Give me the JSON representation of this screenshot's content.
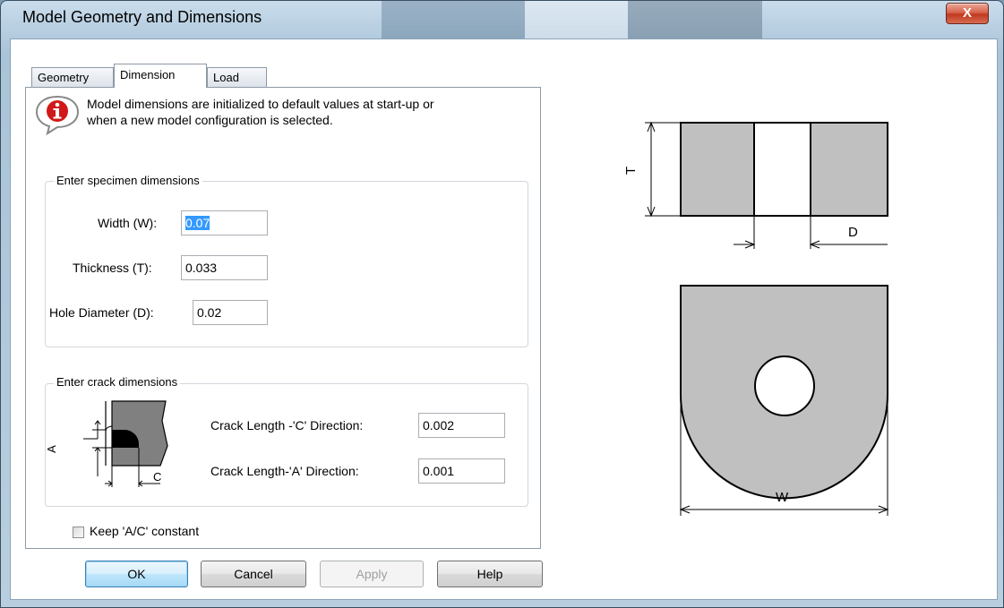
{
  "window": {
    "title": "Model Geometry and Dimensions",
    "close_label": "X"
  },
  "tabs": [
    {
      "label": "Geometry"
    },
    {
      "label": "Dimension"
    },
    {
      "label": "Load"
    }
  ],
  "info": {
    "line1": "Model dimensions are initialized to default values at start-up or",
    "line2": "when a new model  configuration  is  selected."
  },
  "specimen": {
    "legend": "Enter  specimen dimensions",
    "width_label": "Width (W):",
    "width_value": "0.07",
    "thickness_label": "Thickness (T):",
    "thickness_value": "0.033",
    "hole_label": "Hole Diameter (D):",
    "hole_value": "0.02"
  },
  "crack": {
    "legend": "Enter crack dimensions",
    "c_label": "Crack Length -'C' Direction:",
    "c_value": "0.002",
    "a_label": "Crack Length-'A'  Direction:",
    "a_value": "0.001",
    "diagram_a": "A",
    "diagram_c": "C"
  },
  "keep_constant": {
    "label": "Keep 'A/C' constant",
    "checked": false
  },
  "buttons": {
    "ok": "OK",
    "cancel": "Cancel",
    "apply": "Apply",
    "help": "Help"
  },
  "diagram": {
    "t_label": "T",
    "d_label": "D",
    "w_label": "W"
  },
  "colors": {
    "fill": "#c0c0c0",
    "selection": "#3399ff"
  }
}
